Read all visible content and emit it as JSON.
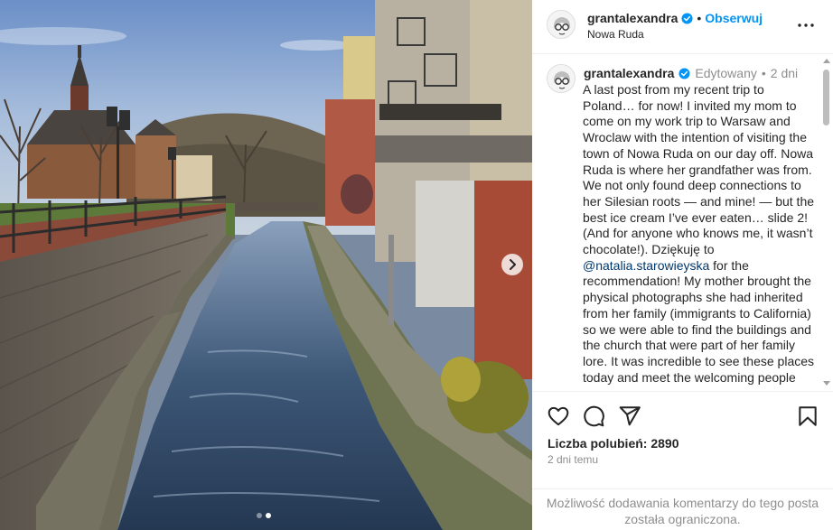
{
  "colors": {
    "accent_blue": "#0095f6",
    "mention_blue": "#00376b",
    "muted_gray": "#8e8e8e",
    "text": "#262626"
  },
  "photo": {
    "alt": "Nowa Ruda canal photo",
    "carousel_slides": 2,
    "current_slide": 1,
    "next_icon": "chevron-right-icon"
  },
  "header": {
    "username": "grantalexandra",
    "separator": "•",
    "follow_label": "Obserwuj",
    "location": "Nowa Ruda",
    "more_icon": "more-options-icon"
  },
  "caption": {
    "username": "grantalexandra",
    "edited": "Edytowany",
    "separator": "•",
    "age": "2 dni",
    "text_before": "A last post from my recent trip to Poland… for now! I invited my mom to come on my work trip to Warsaw and Wroclaw with the intention of visiting the town of Nowa Ruda on our day off. Nowa Ruda is where her grandfather was from. We not only found deep connections to her Silesian roots — and mine! — but the best ice cream I’ve ever eaten… slide 2! (And for anyone who knows me, it wasn’t chocolate!). Dziękuję to ",
    "mention": "@natalia.starowieyska",
    "text_after": " for the recommendation! My mother brought the physical photographs she had inherited from her family (immigrants to California) so we were able to find the buildings and the church that were part of her family lore. It was incredible to see these places today and meet the welcoming people"
  },
  "actions": {
    "icons": [
      "heart-icon",
      "comment-icon",
      "share-icon",
      "bookmark-icon"
    ],
    "likes_label": "Liczba polubień: 2890",
    "time_label": "2 dni temu"
  },
  "comments": {
    "disabled_text": "Możliwość dodawania komentarzy do tego posta została ograniczona."
  }
}
